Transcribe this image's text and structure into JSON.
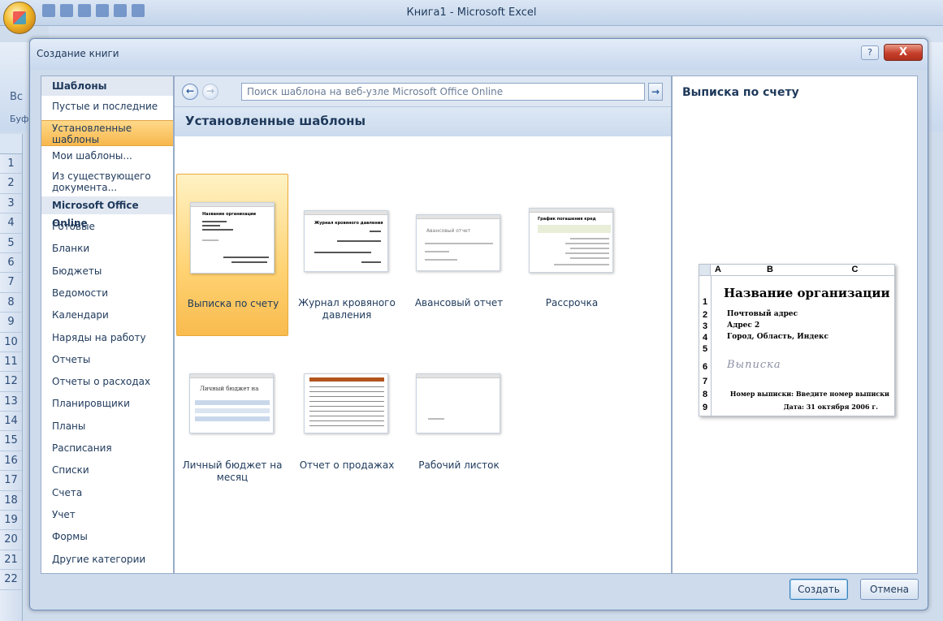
{
  "excel": {
    "window_title": "Книга1 - Microsoft Excel",
    "row_numbers": [
      "1",
      "2",
      "3",
      "4",
      "5",
      "6",
      "7",
      "8",
      "9",
      "10",
      "11",
      "12",
      "13",
      "14",
      "15",
      "16",
      "17",
      "18",
      "19",
      "20",
      "21",
      "22"
    ],
    "side_snippets": [
      "Вс",
      "Буфе"
    ]
  },
  "dialog": {
    "title": "Создание книги",
    "help_label": "?",
    "close_label": "X",
    "left_pane": {
      "header": "Шаблоны",
      "items_top": [
        "Пустые и последние",
        "Установленные шаблоны",
        "Мои шаблоны...",
        "Из существующего документа..."
      ],
      "selected_index": 1,
      "section_online": "Microsoft Office Online",
      "categories": [
        "Готовые",
        "Бланки",
        "Бюджеты",
        "Ведомости",
        "Календари",
        "Наряды на работу",
        "Отчеты",
        "Отчеты о расходах",
        "Планировщики",
        "Планы",
        "Расписания",
        "Списки",
        "Счета",
        "Учет",
        "Формы",
        "Другие категории"
      ]
    },
    "center_pane": {
      "back_icon": "←",
      "forward_icon": "→",
      "search_placeholder": "Поиск шаблона на веб-узле Microsoft Office Online",
      "search_go_icon": "→",
      "section_title": "Установленные шаблоны",
      "templates": [
        {
          "label": "Выписка по счету",
          "thumb_text": "Название организации"
        },
        {
          "label": "Журнал кровяного давления",
          "thumb_text": "Журнал кровяного давления"
        },
        {
          "label": "Авансовый отчет",
          "thumb_text": "Авансовый отчет"
        },
        {
          "label": "Рассрочка",
          "thumb_text": "График погашения кред"
        },
        {
          "label": "Личный бюджет на месяц",
          "thumb_text": "Личный бюджет на"
        },
        {
          "label": "Отчет о продажах",
          "thumb_text": ""
        },
        {
          "label": "Рабочий листок",
          "thumb_text": ""
        }
      ],
      "selected_template": 0
    },
    "right_pane": {
      "title": "Выписка по счету",
      "preview": {
        "col_a": "A",
        "col_b": "B",
        "col_c": "C",
        "rows": [
          "1",
          "2",
          "3",
          "4",
          "5",
          "6",
          "7",
          "8",
          "9"
        ],
        "org_name": "Название организации",
        "postal": "Почтовый адрес",
        "address": "Адрес 2",
        "city": "Город, Область, Индекс",
        "statement": "Выписка",
        "number_line": "Номер выписки: Введите номер выписки",
        "date_line": "Дата: 31 октября 2006 г."
      }
    },
    "buttons": {
      "create": "Создать",
      "cancel": "Отмена"
    }
  },
  "colors": {
    "selected_fill": "#f7b74c",
    "dialog_bg": "#cddbed",
    "close_red": "#c6402b"
  }
}
